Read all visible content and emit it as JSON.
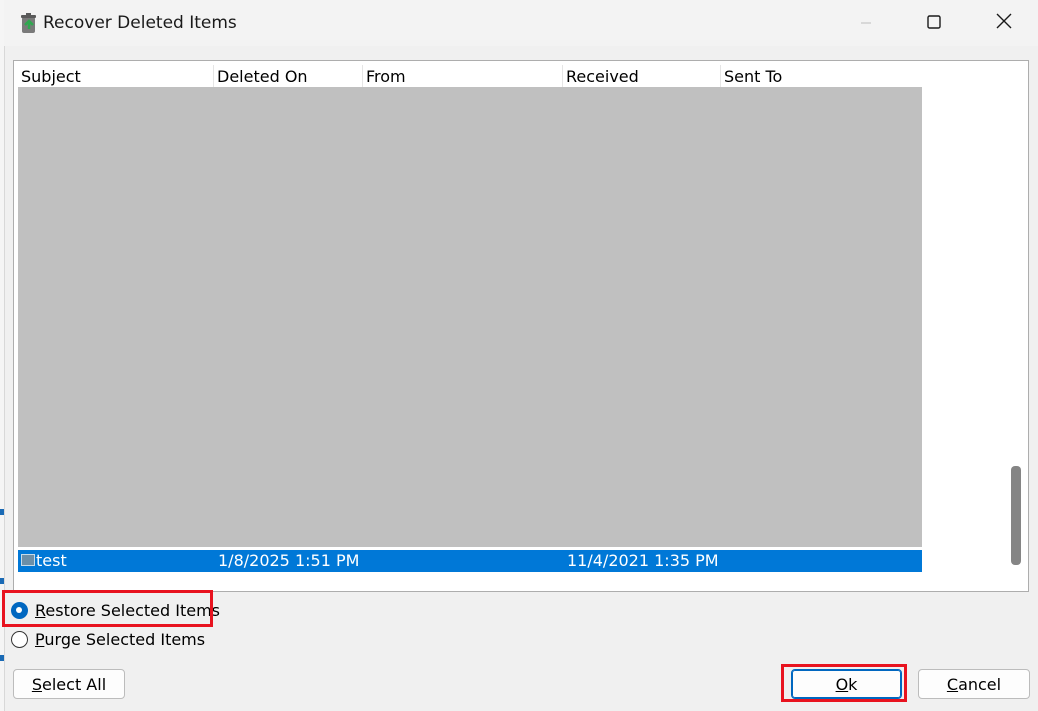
{
  "window": {
    "title": "Recover Deleted Items",
    "minimize_icon": "minimize-icon",
    "maximize_icon": "maximize-icon",
    "close_icon": "close-icon"
  },
  "list": {
    "columns": [
      "Subject",
      "Deleted On",
      "From",
      "Received",
      "Sent To"
    ],
    "rows": [
      {
        "subject": "test",
        "deleted_on": "1/8/2025 1:51 PM",
        "from": "",
        "received": "11/4/2021 1:35 PM",
        "sent_to": "",
        "selected": true
      }
    ]
  },
  "options": {
    "restore_prefix": "R",
    "restore_rest": "estore Selected Items",
    "restore_checked": true,
    "purge_prefix": "P",
    "purge_rest": "urge Selected Items",
    "purge_checked": false
  },
  "buttons": {
    "select_all_prefix": "S",
    "select_all_rest": "elect All",
    "ok_prefix": "O",
    "ok_rest": "k",
    "cancel_prefix": "C",
    "cancel_rest": "ancel"
  },
  "colors": {
    "highlight": "#e8131f",
    "selection": "#0078d7",
    "accent": "#0067c0"
  }
}
